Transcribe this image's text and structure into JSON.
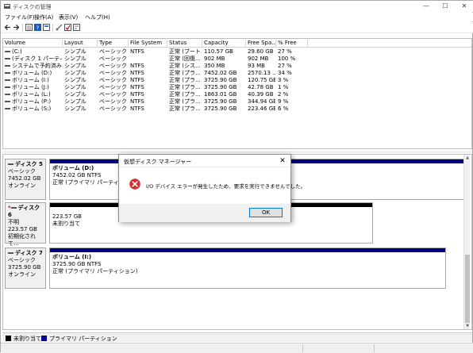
{
  "window": {
    "title": "ディスクの管理",
    "minimize": "—",
    "maximize": "☐",
    "close": "✕"
  },
  "menu": [
    "ファイル(F)",
    "操作(A)",
    "表示(V)",
    "ヘルプ(H)"
  ],
  "volume_table": {
    "headers": [
      "Volume",
      "Layout",
      "Type",
      "File System",
      "Status",
      "Capacity",
      "Free Spa...",
      "% Free"
    ],
    "rows": [
      [
        "(C:)",
        "シンプル",
        "ベーシック",
        "NTFS",
        "正常 (ブート...",
        "110.57 GB",
        "29.60 GB",
        "27 %"
      ],
      [
        "(ディスク 1 パーティシ...",
        "シンプル",
        "ベーシック",
        "",
        "正常 (回復...",
        "902 MB",
        "902 MB",
        "100 %"
      ],
      [
        "システムで予約済み",
        "シンプル",
        "ベーシック",
        "NTFS",
        "正常 (シス...",
        "350 MB",
        "93 MB",
        "27 %"
      ],
      [
        "ボリューム (D:)",
        "シンプル",
        "ベーシック",
        "NTFS",
        "正常 (プラ...",
        "7452.02 GB",
        "2570.13 ...",
        "34 %"
      ],
      [
        "ボリューム (I:)",
        "シンプル",
        "ベーシック",
        "NTFS",
        "正常 (プラ...",
        "3725.90 GB",
        "120.75 GB",
        "3 %"
      ],
      [
        "ボリューム (J:)",
        "シンプル",
        "ベーシック",
        "NTFS",
        "正常 (プラ...",
        "3725.90 GB",
        "42.78 GB",
        "1 %"
      ],
      [
        "ボリューム (L:)",
        "シンプル",
        "ベーシック",
        "NTFS",
        "正常 (プラ...",
        "1863.01 GB",
        "40.39 GB",
        "2 %"
      ],
      [
        "ボリューム (P:)",
        "シンプル",
        "ベーシック",
        "NTFS",
        "正常 (プラ...",
        "3725.90 GB",
        "344.94 GB",
        "9 %"
      ],
      [
        "ボリューム (S:)",
        "シンプル",
        "ベーシック",
        "NTFS",
        "正常 (プラ...",
        "3725.90 GB",
        "223.46 GB",
        "6 %"
      ]
    ]
  },
  "disks": [
    {
      "name": "ディスク 5",
      "type": "ベーシック",
      "size": "7452.02 GB",
      "state": "オンライン",
      "partition": {
        "name": "ボリューム (D:)",
        "detail": "7452.02 GB NTFS",
        "status": "正常 (プライマリ パーティション)"
      }
    },
    {
      "name": "ディスク 6",
      "marker": "*",
      "type": "不明",
      "size": "223.57 GB",
      "state": "初期化されて...",
      "partition": {
        "name": "",
        "detail": "223.57 GB",
        "status": "未割り当て"
      }
    },
    {
      "name": "ディスク 7",
      "type": "ベーシック",
      "size": "3725.90 GB",
      "state": "オンライン",
      "partition": {
        "name": "ボリューム (I:)",
        "detail": "3725.90 GB NTFS",
        "status": "正常 (プライマリ パーティション)"
      }
    }
  ],
  "legend": {
    "unallocated": "未割り当て",
    "primary": "プライマリ パーティション"
  },
  "dialog": {
    "title": "仮想ディスク マネージャー",
    "close": "✕",
    "message": "I/O デバイス エラーが発生したため、要求を実行できませんでした。",
    "ok": "OK"
  },
  "colors": {
    "primary_partition": "#000080",
    "unallocated": "#000000",
    "error_red": "#d32f2f"
  }
}
